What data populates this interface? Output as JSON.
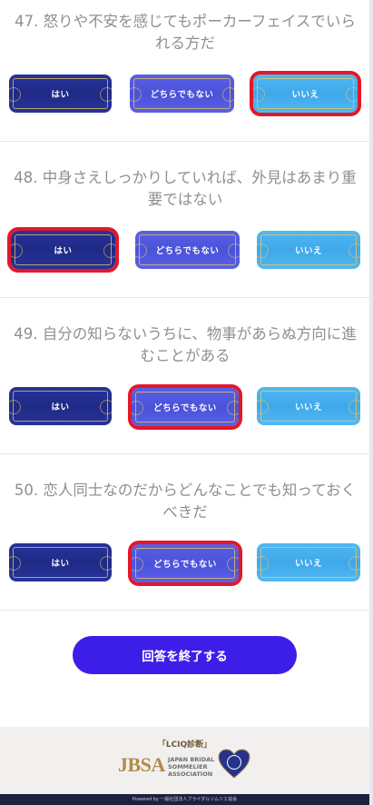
{
  "questions": [
    {
      "text": "47. 怒りや不安を感じてもポーカーフェイスでいられる方だ",
      "selected": "no"
    },
    {
      "text": "48. 中身さえしっかりしていれば、外見はあまり重要ではない",
      "selected": "yes"
    },
    {
      "text": "49. 自分の知らないうちに、物事があらぬ方向に進むことがある",
      "selected": "neutral"
    },
    {
      "text": "50. 恋人同士なのだからどんなことでも知っておくべきだ",
      "selected": "neutral"
    }
  ],
  "options": {
    "yes": "はい",
    "neutral": "どちらでもない",
    "no": "いいえ"
  },
  "submit_label": "回答を終了する",
  "footer": {
    "lciq": "「LCIQ診断」",
    "jbsa": "JBSA",
    "assoc_line1": "JAPAN BRIDAL",
    "assoc_line2": "SOMMELIER",
    "assoc_line3": "ASSOCIATION",
    "powered": "Powered by 一般社団法人ブライダルソムリエ協会"
  },
  "colors": {
    "accent": "#3d1ee8",
    "selected_outline": "#e3172a",
    "yes": "#27339a",
    "neutral": "#5960e8",
    "no": "#50b8f2"
  }
}
